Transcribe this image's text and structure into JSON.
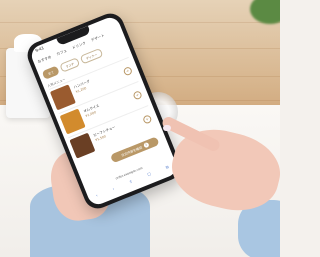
{
  "phone": {
    "status_time": "9:41",
    "nav": [
      "おすすめ",
      "カフェ",
      "ドリンク",
      "デザート"
    ],
    "filters": [
      {
        "label": "全て",
        "active": true
      },
      {
        "label": "ランチ",
        "active": false
      },
      {
        "label": "ディナー",
        "active": false
      }
    ],
    "section_title": "人気メニュー",
    "items": [
      {
        "name": "ハンバーグ",
        "price": "¥1,200",
        "thumb_color": "#9a5b2f"
      },
      {
        "name": "オムライス",
        "price": "¥1,000",
        "thumb_color": "#d28b2d"
      },
      {
        "name": "ビーフシチュー",
        "price": "¥1,500",
        "thumb_color": "#6a3f24"
      }
    ],
    "cta": {
      "label": "注文内容を確認",
      "count": "3"
    },
    "url": "order.example.com",
    "bottom_icons": [
      "‹",
      "›",
      "⇪",
      "☐",
      "⧉"
    ]
  },
  "colors": {
    "accent": "#b99867",
    "sleeve": "#a8c4df"
  }
}
